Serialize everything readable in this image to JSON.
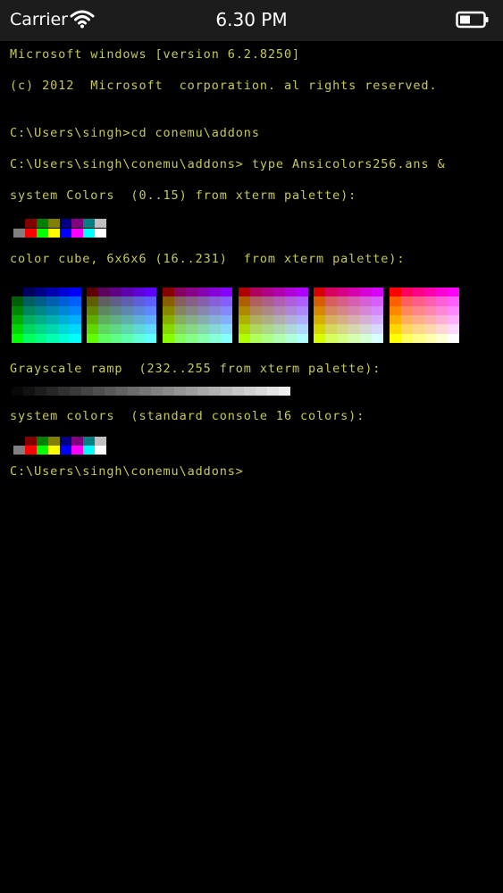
{
  "status_bar": {
    "carrier": "Carrier",
    "time": "6.30 PM",
    "icons": [
      "wifi-icon",
      "battery-icon"
    ]
  },
  "terminal": {
    "text_color": "#c8c85a",
    "lines": {
      "l1": "Microsoft windows [version 6.2.8250]",
      "l2": "(c) 2012  Microsoft  corporation. al rights reserved.",
      "l3": "C:\\Users\\singh>cd conemu\\addons",
      "l4": "C:\\Users\\singh\\conemu\\addons> type Ansicolors256.ans &",
      "l5": "system Colors  (0..15) from xterm palette):",
      "l6": "color cube, 6x6x6 (16..231)  from xterm palette):",
      "l7": "Grayscale ramp  (232..255 from xterm palette):",
      "l8": "system colors  (standard console 16 colors):",
      "l9": "C:\\Users\\singh\\conemu\\addons>"
    },
    "system_colors_dark": [
      "#000000",
      "#800000",
      "#008000",
      "#808000",
      "#000080",
      "#800080",
      "#008080",
      "#c0c0c0"
    ],
    "system_colors_bright": [
      "#808080",
      "#ff0000",
      "#00ff00",
      "#ffff00",
      "#0000ff",
      "#ff00ff",
      "#00ffff",
      "#ffffff"
    ],
    "cube_levels": [
      0,
      95,
      135,
      175,
      215,
      255
    ],
    "gray_ramp_start": 8,
    "gray_ramp_step": 10,
    "gray_ramp_count": 24
  }
}
